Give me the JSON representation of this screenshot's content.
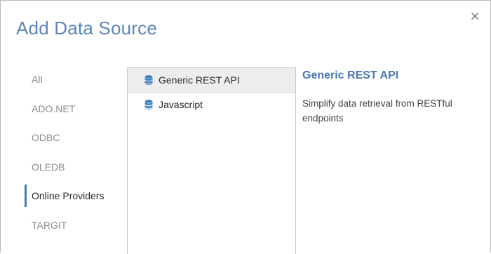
{
  "dialog": {
    "title": "Add Data Source"
  },
  "categories": [
    {
      "label": "All",
      "active": false
    },
    {
      "label": "ADO.NET",
      "active": false
    },
    {
      "label": "ODBC",
      "active": false
    },
    {
      "label": "OLEDB",
      "active": false
    },
    {
      "label": "Online Providers",
      "active": true
    },
    {
      "label": "TARGIT",
      "active": false
    }
  ],
  "providers": [
    {
      "label": "Generic REST API",
      "icon": "database-icon",
      "selected": true
    },
    {
      "label": "Javascript",
      "icon": "database-icon",
      "selected": false
    }
  ],
  "detail": {
    "title": "Generic REST API",
    "description": "Simplify data retrieval from RESTful endpoints"
  },
  "colors": {
    "accent": "#4b78b4",
    "title": "#5b86b8",
    "icon": "#3a7fc2"
  }
}
